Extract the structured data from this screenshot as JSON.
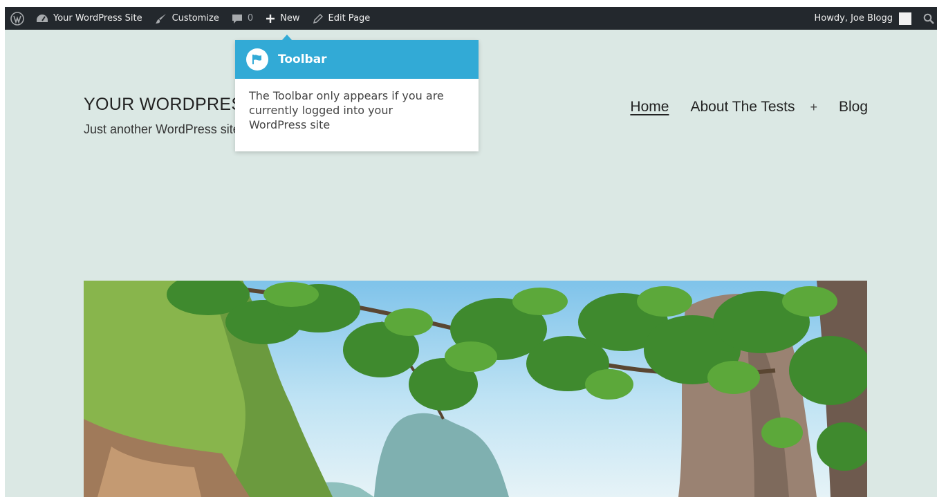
{
  "adminbar": {
    "wp_logo_icon": "wordpress-logo-icon",
    "site_name": "Your WordPress Site",
    "customize": "Customize",
    "comments_count": "0",
    "new": "New",
    "edit_page": "Edit Page",
    "howdy": "Howdy, Joe Blogg",
    "search_icon": "search-icon"
  },
  "site": {
    "title": "YOUR WORDPRESS SITE",
    "description": "Just another WordPress site"
  },
  "nav": {
    "items": [
      "Home",
      "About The Tests",
      "+",
      "Blog"
    ]
  },
  "tooltip": {
    "title": "Toolbar",
    "lines": [
      "The Toolbar only appears if you are",
      "currently logged into your",
      "WordPress site"
    ]
  },
  "colors": {
    "adminbar_bg": "#23282d",
    "page_bg": "#dbe8e4",
    "tooltip_accent": "#32aad6"
  }
}
